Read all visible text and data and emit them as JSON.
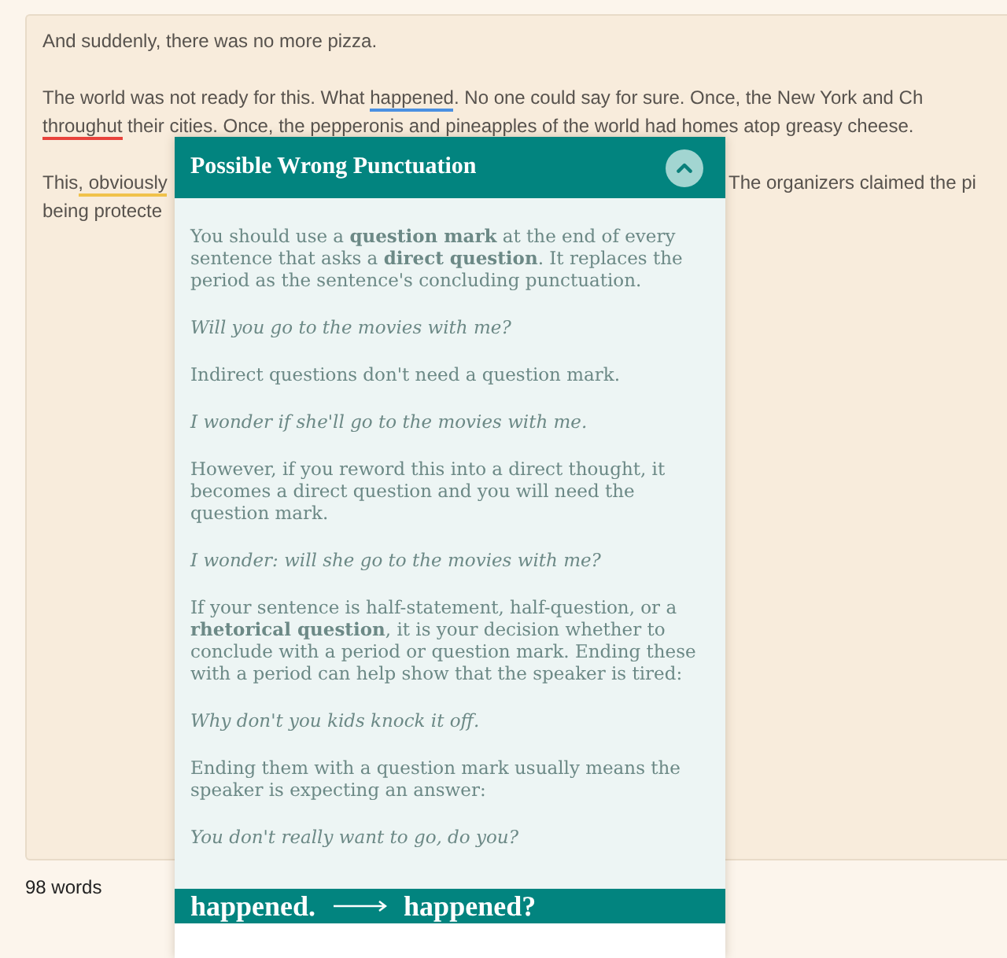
{
  "editor": {
    "paragraphs": [
      {
        "lines": [
          {
            "left": [
              {
                "text": "And suddenly, there was no more pizza."
              }
            ]
          }
        ]
      },
      {
        "lines": [
          {
            "left": [
              {
                "text": "The world was not ready for this. What "
              },
              {
                "text": "happened",
                "color": "#4a90e2"
              },
              {
                "text": ". No one could say for sure. Once, the New York and Ch"
              }
            ]
          },
          {
            "left": [
              {
                "text": "throughut",
                "color": "#e8433c"
              },
              {
                "text": " their cities. Once, the pepperonis and pineapples of the world had homes atop greasy cheese."
              }
            ]
          }
        ]
      },
      {
        "lines": [
          {
            "left": [
              {
                "text": "This"
              },
              {
                "text": ", obviously",
                "color": "#f0c24b"
              }
            ],
            "right": [
              {
                "text": "The organizers claimed the pi"
              }
            ]
          },
          {
            "left": [
              {
                "text": "being protecte"
              }
            ]
          }
        ]
      }
    ]
  },
  "status": {
    "word_count": "98 words"
  },
  "popup": {
    "title": "Possible Wrong Punctuation",
    "expanded": true,
    "body": [
      {
        "kind": "text",
        "text": "You should use a **question mark** at the end of every sentence that asks a **direct question**. It replaces the period as the sentence's concluding punctuation."
      },
      {
        "kind": "example",
        "text": "Will you go to the movies with me?"
      },
      {
        "kind": "text",
        "text": "Indirect questions don't need a question mark."
      },
      {
        "kind": "example",
        "text": "I wonder if she'll go to the movies with me."
      },
      {
        "kind": "text",
        "text": "However, if you reword this into a direct thought, it becomes a direct question and you will need the question mark."
      },
      {
        "kind": "example",
        "text": "I wonder: will she go to the movies with me?"
      },
      {
        "kind": "text",
        "text": "If your sentence is half-statement, half-question, or a **rhetorical question**, it is your decision whether to conclude with a period or question mark. Ending these with a period can help show that the speaker is tired:"
      },
      {
        "kind": "example",
        "text": "Why don't you kids knock it off."
      },
      {
        "kind": "text",
        "text": "Ending them with a question mark usually means the speaker is expecting an answer:"
      },
      {
        "kind": "example",
        "text": "You don't really want to go, do you?"
      }
    ],
    "suggestion": {
      "original": "happened.",
      "replacement": "happened?"
    }
  }
}
